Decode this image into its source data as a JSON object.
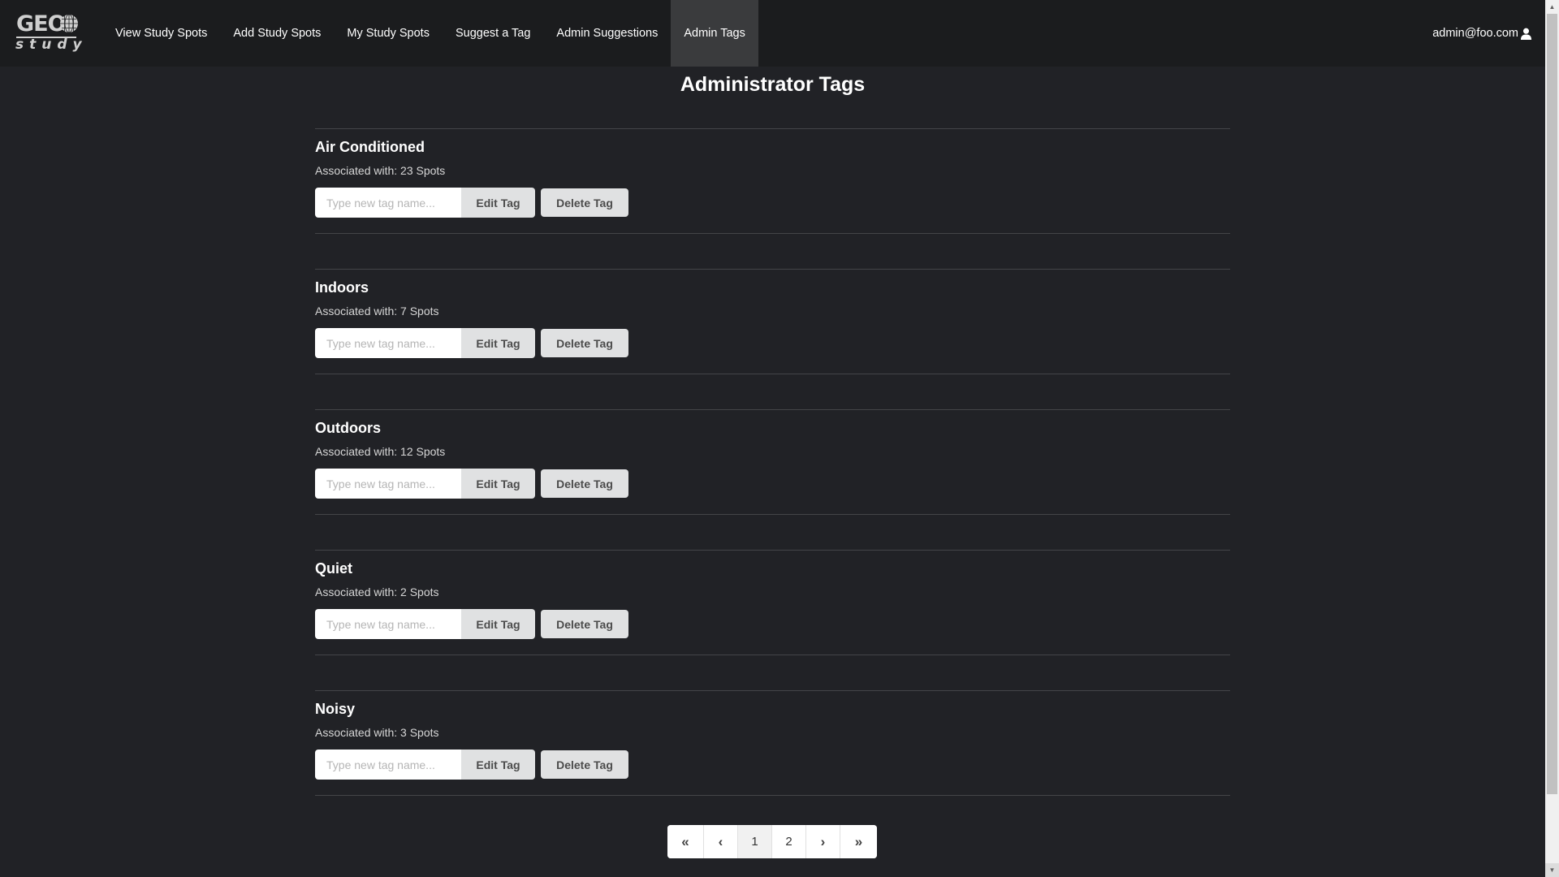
{
  "navbar": {
    "logo": {
      "top_text": "GEO",
      "bottom_text": "study"
    },
    "links": [
      {
        "label": "View Study Spots",
        "active": false
      },
      {
        "label": "Add Study Spots",
        "active": false
      },
      {
        "label": "My Study Spots",
        "active": false
      },
      {
        "label": "Suggest a Tag",
        "active": false
      },
      {
        "label": "Admin Suggestions",
        "active": false
      },
      {
        "label": "Admin Tags",
        "active": true
      }
    ],
    "user_email": "admin@foo.com",
    "user_icon": "user-icon"
  },
  "main": {
    "title": "Administrator Tags",
    "input_placeholder": "Type new tag name...",
    "edit_label": "Edit Tag",
    "delete_label": "Delete Tag",
    "tags": [
      {
        "name": "Air Conditioned",
        "count_text": "Associated with: 23 Spots",
        "count": 23
      },
      {
        "name": "Indoors",
        "count_text": "Associated with: 7 Spots",
        "count": 7
      },
      {
        "name": "Outdoors",
        "count_text": "Associated with: 12 Spots",
        "count": 12
      },
      {
        "name": "Quiet",
        "count_text": "Associated with: 2 Spots",
        "count": 2
      },
      {
        "name": "Noisy",
        "count_text": "Associated with: 3 Spots",
        "count": 3
      }
    ]
  },
  "pagination": {
    "first": "«",
    "prev": "‹",
    "pages": [
      "1",
      "2"
    ],
    "current_page": "1",
    "next": "›",
    "last": "»"
  },
  "colors": {
    "background": "#212226",
    "navbar": "#1b1c1e",
    "nav_active": "#3a3b3d",
    "button": "#e0e1e2"
  }
}
